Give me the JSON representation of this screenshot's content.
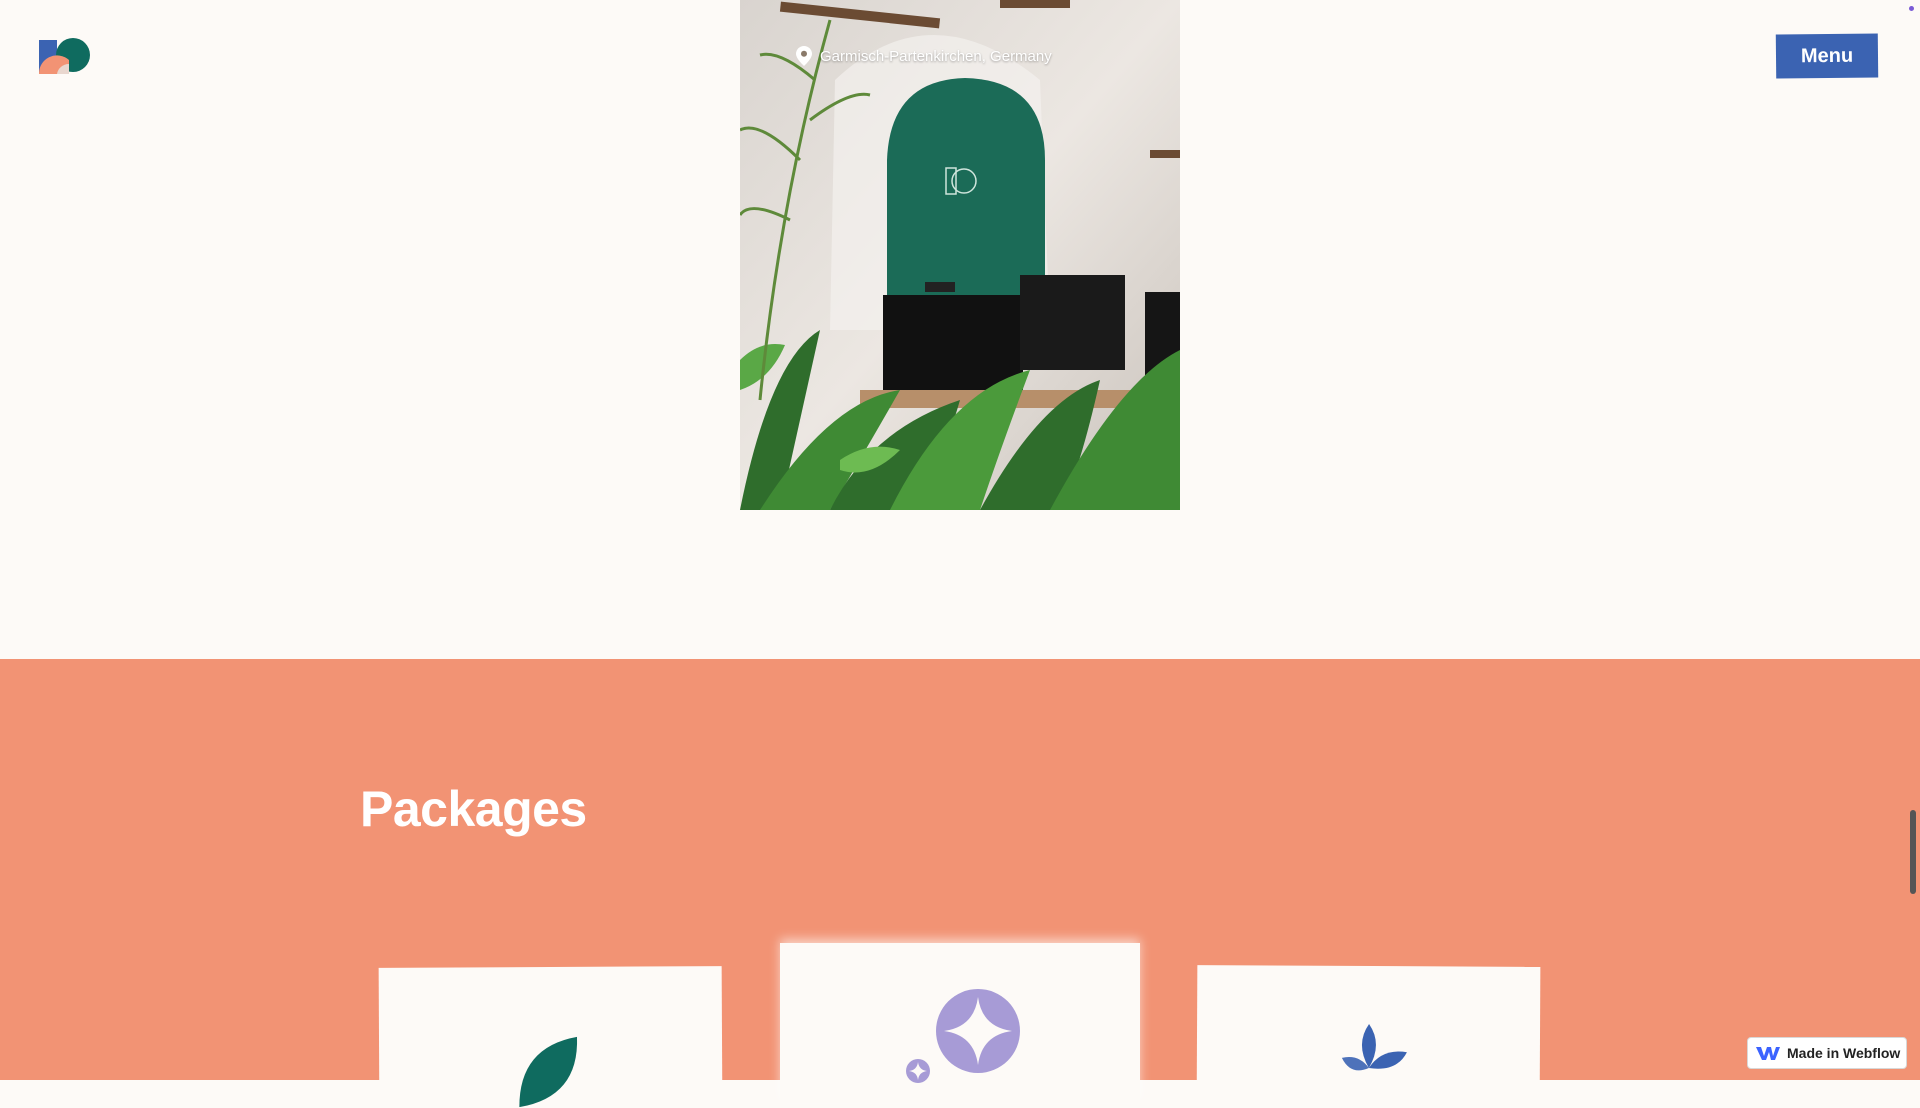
{
  "header": {
    "logo_icon": "brand-logo-icon",
    "menu_label": "Menu"
  },
  "hero_photo": {
    "location_icon": "map-pin-icon",
    "location_text": "Garmisch-Partenkirchen, Germany"
  },
  "packages": {
    "title": "Packages",
    "cards": [
      {
        "icon": "leaf-icon",
        "color": "#0f6b5f"
      },
      {
        "icon": "sparkle-icon",
        "color": "#a79bd6"
      },
      {
        "icon": "sprout-icon",
        "color": "#3b63b2"
      }
    ]
  },
  "badge": {
    "icon": "webflow-icon",
    "label": "Made in Webflow"
  },
  "colors": {
    "background": "#fdfaf7",
    "section": "#f29374",
    "accent_blue": "#3b63b2",
    "accent_green": "#0f6b5f"
  }
}
